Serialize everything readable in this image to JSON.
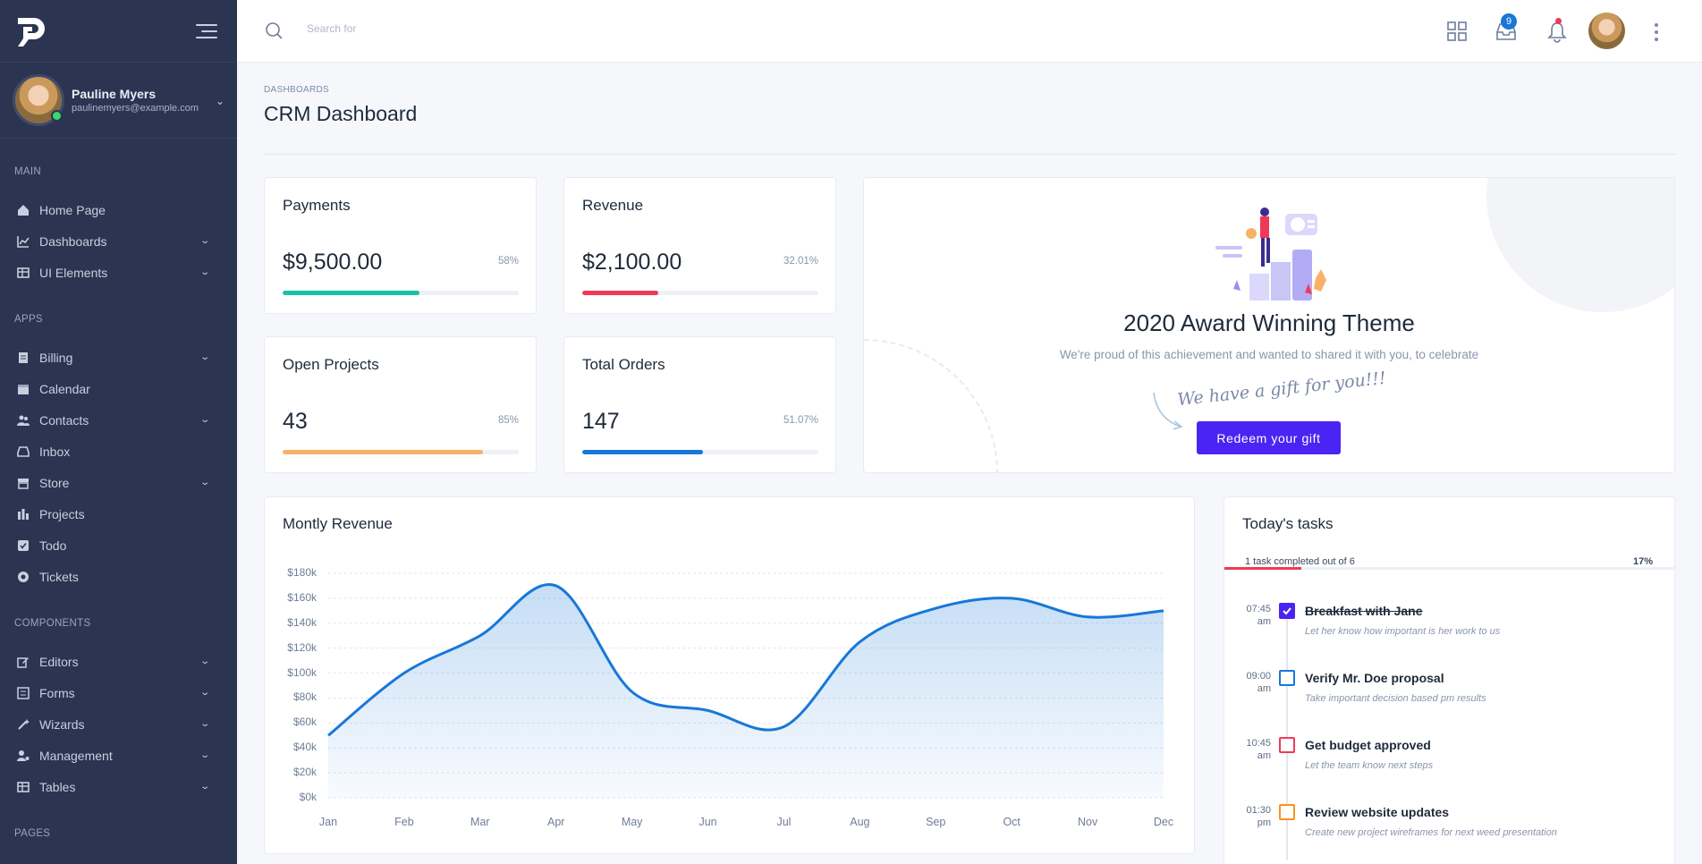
{
  "sidebar": {
    "user": {
      "name": "Pauline Myers",
      "email": "paulinemyers@example.com"
    },
    "sections": [
      {
        "title": "Main",
        "items": [
          {
            "label": "Home Page",
            "icon": "home-icon",
            "has_submenu": false
          },
          {
            "label": "Dashboards",
            "icon": "chart-icon",
            "has_submenu": true
          },
          {
            "label": "UI Elements",
            "icon": "table-icon",
            "has_submenu": true
          }
        ]
      },
      {
        "title": "Apps",
        "items": [
          {
            "label": "Billing",
            "icon": "document-icon",
            "has_submenu": true
          },
          {
            "label": "Calendar",
            "icon": "calendar-icon",
            "has_submenu": false
          },
          {
            "label": "Contacts",
            "icon": "users-icon",
            "has_submenu": true
          },
          {
            "label": "Inbox",
            "icon": "inbox-icon",
            "has_submenu": false
          },
          {
            "label": "Store",
            "icon": "store-icon",
            "has_submenu": true
          },
          {
            "label": "Projects",
            "icon": "projects-icon",
            "has_submenu": false
          },
          {
            "label": "Todo",
            "icon": "check-square-icon",
            "has_submenu": false
          },
          {
            "label": "Tickets",
            "icon": "lifebuoy-icon",
            "has_submenu": false
          }
        ]
      },
      {
        "title": "Components",
        "items": [
          {
            "label": "Editors",
            "icon": "edit-icon",
            "has_submenu": true
          },
          {
            "label": "Forms",
            "icon": "form-icon",
            "has_submenu": true
          },
          {
            "label": "Wizards",
            "icon": "wand-icon",
            "has_submenu": true
          },
          {
            "label": "Management",
            "icon": "user-cog-icon",
            "has_submenu": true
          },
          {
            "label": "Tables",
            "icon": "table-icon",
            "has_submenu": true
          }
        ]
      },
      {
        "title": "Pages",
        "items": []
      }
    ]
  },
  "topbar": {
    "search_placeholder": "Search for",
    "inbox_badge": "9"
  },
  "header": {
    "breadcrumb": "DASHBOARDS",
    "title": "CRM Dashboard"
  },
  "stats": [
    {
      "title": "Payments",
      "value": "$9,500.00",
      "percent_label": "58%",
      "progress": 0.58,
      "color": "#17c3a5"
    },
    {
      "title": "Revenue",
      "value": "$2,100.00",
      "percent_label": "32.01%",
      "progress": 0.3201,
      "color": "#ee3a58"
    },
    {
      "title": "Open Projects",
      "value": "43",
      "percent_label": "85%",
      "progress": 0.85,
      "color": "#f7b267"
    },
    {
      "title": "Total Orders",
      "value": "147",
      "percent_label": "51.07%",
      "progress": 0.5107,
      "color": "#1877d8"
    }
  ],
  "promo": {
    "title": "2020 Award Winning Theme",
    "subtitle": "We're proud of this achievement and wanted to shared it with you, to celebrate",
    "gift_text": "We have a gift for you!!!",
    "button_label": "Redeem your gift",
    "button_color": "#4a24f3"
  },
  "revenue_chart": {
    "title": "Montly Revenue",
    "chart_data": {
      "type": "area",
      "title": "Montly Revenue",
      "x": [
        "Jan",
        "Feb",
        "Mar",
        "Apr",
        "May",
        "Jun",
        "Jul",
        "Aug",
        "Sep",
        "Oct",
        "Nov",
        "Dec"
      ],
      "series": [
        {
          "values": [
            50,
            100,
            130,
            170,
            85,
            70,
            57,
            125,
            152,
            160,
            145,
            150
          ]
        }
      ],
      "y_ticks": [
        "$0k",
        "$20k",
        "$40k",
        "$60k",
        "$80k",
        "$100k",
        "$120k",
        "$140k",
        "$160k",
        "$180k"
      ],
      "ylim": [
        0,
        180
      ],
      "grid": true,
      "color": "#1877d8"
    }
  },
  "tasks": {
    "title": "Today's tasks",
    "summary": "1 task completed out of 6",
    "percent_label": "17%",
    "progress": 0.17,
    "items": [
      {
        "time": "07:45",
        "ampm": "am",
        "name": "Breakfast with Jane",
        "desc": "Let her know how important is her work to us",
        "done": true,
        "color": "#4a24f3"
      },
      {
        "time": "09:00",
        "ampm": "am",
        "name": "Verify Mr. Doe proposal",
        "desc": "Take important decision based pm results",
        "done": false,
        "color": "#1877d8"
      },
      {
        "time": "10:45",
        "ampm": "am",
        "name": "Get budget approved",
        "desc": "Let the team know next steps",
        "done": false,
        "color": "#ee3a58"
      },
      {
        "time": "01:30",
        "ampm": "pm",
        "name": "Review website updates",
        "desc": "Create new project wireframes for next weed presentation",
        "done": false,
        "color": "#f7941d"
      }
    ]
  }
}
